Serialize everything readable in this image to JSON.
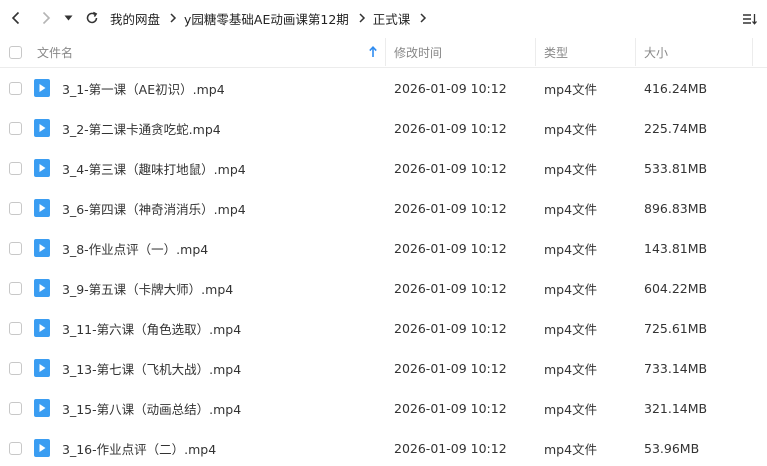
{
  "breadcrumb": [
    "我的网盘",
    "y园糖零基础AE动画课第12期",
    "正式课"
  ],
  "header": {
    "name": "文件名",
    "mtime": "修改时间",
    "type": "类型",
    "size": "大小"
  },
  "colors": {
    "accent": "#2f8cf0",
    "video_icon": "#3a9df2"
  },
  "files": [
    {
      "name": "3_1-第一课（AE初识）.mp4",
      "mtime": "2026-01-09 10:12",
      "type": "mp4文件",
      "size": "416.24MB"
    },
    {
      "name": "3_2-第二课卡通贪吃蛇.mp4",
      "mtime": "2026-01-09 10:12",
      "type": "mp4文件",
      "size": "225.74MB"
    },
    {
      "name": "3_4-第三课（趣味打地鼠）.mp4",
      "mtime": "2026-01-09 10:12",
      "type": "mp4文件",
      "size": "533.81MB"
    },
    {
      "name": "3_6-第四课（神奇消消乐）.mp4",
      "mtime": "2026-01-09 10:12",
      "type": "mp4文件",
      "size": "896.83MB"
    },
    {
      "name": "3_8-作业点评（一）.mp4",
      "mtime": "2026-01-09 10:12",
      "type": "mp4文件",
      "size": "143.81MB"
    },
    {
      "name": "3_9-第五课（卡牌大师）.mp4",
      "mtime": "2026-01-09 10:12",
      "type": "mp4文件",
      "size": "604.22MB"
    },
    {
      "name": "3_11-第六课（角色选取）.mp4",
      "mtime": "2026-01-09 10:12",
      "type": "mp4文件",
      "size": "725.61MB"
    },
    {
      "name": "3_13-第七课（飞机大战）.mp4",
      "mtime": "2026-01-09 10:12",
      "type": "mp4文件",
      "size": "733.14MB"
    },
    {
      "name": "3_15-第八课（动画总结）.mp4",
      "mtime": "2026-01-09 10:12",
      "type": "mp4文件",
      "size": "321.14MB"
    },
    {
      "name": "3_16-作业点评（二）.mp4",
      "mtime": "2026-01-09 10:12",
      "type": "mp4文件",
      "size": "53.96MB"
    }
  ]
}
